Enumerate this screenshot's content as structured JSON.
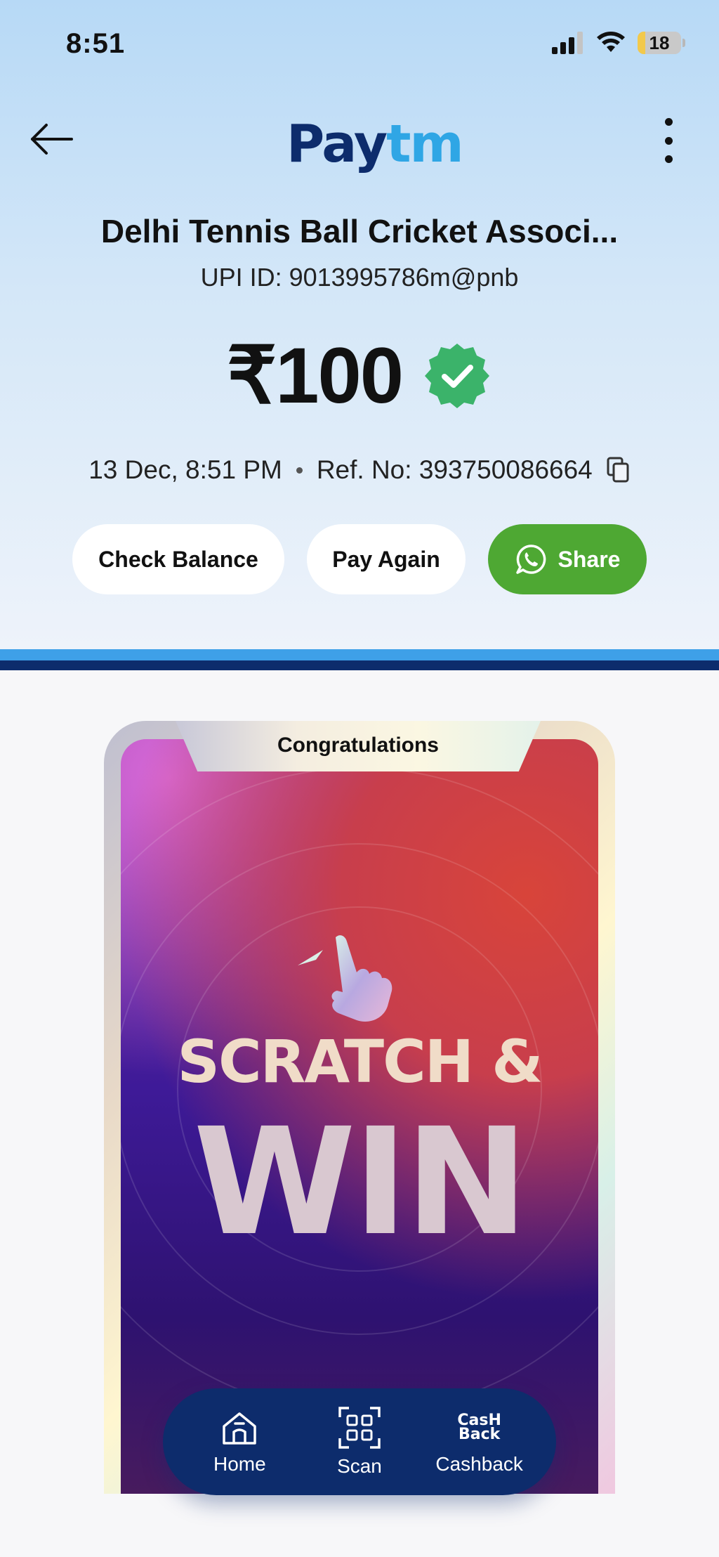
{
  "status_bar": {
    "time": "8:51",
    "battery": "18"
  },
  "header": {
    "logo_part1": "Pay",
    "logo_part2": "tm"
  },
  "merchant": {
    "name": "Delhi Tennis Ball Cricket Associ...",
    "upi": "UPI ID: 9013995786m@pnb"
  },
  "payment": {
    "amount": "₹100",
    "datetime": "13 Dec, 8:51 PM",
    "ref": "Ref. No: 393750086664"
  },
  "actions": {
    "check_balance": "Check Balance",
    "pay_again": "Pay Again",
    "share": "Share"
  },
  "reward_card": {
    "tab_label": "Congratulations",
    "line1": "SCRATCH &",
    "line2": "WIN"
  },
  "bottom_nav": {
    "home": "Home",
    "scan": "Scan",
    "cashback": "Cashback",
    "cashback_icon_line1": "CasH",
    "cashback_icon_line2": "Back"
  },
  "colors": {
    "brand_navy": "#0d2c6c",
    "brand_blue": "#2fa6e5",
    "share_green": "#4ea833",
    "success_green": "#3bb36a"
  }
}
